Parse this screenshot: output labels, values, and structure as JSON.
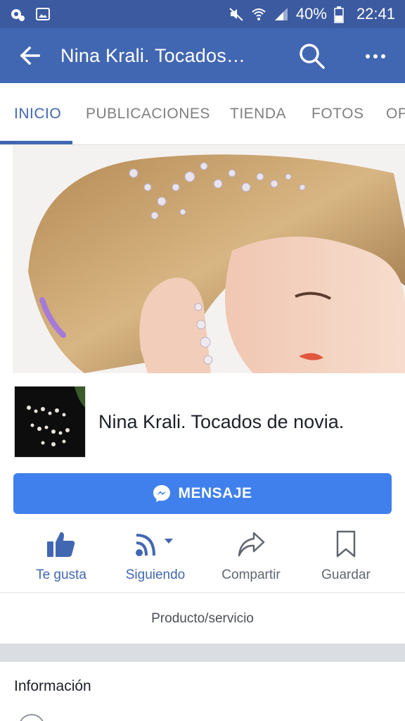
{
  "status_bar": {
    "battery": "40%",
    "time": "22:41",
    "icons": [
      "settings-notification-icon",
      "gallery-notification-icon",
      "mute-icon",
      "wifi-icon",
      "signal-icon",
      "battery-icon"
    ]
  },
  "app_bar": {
    "title": "Nina Krali. Tocados…",
    "icons": [
      "back-arrow-icon",
      "search-icon",
      "more-icon"
    ]
  },
  "tabs": [
    {
      "label": "INICIO",
      "active": true
    },
    {
      "label": "PUBLICACIONES",
      "active": false
    },
    {
      "label": "TIENDA",
      "active": false
    },
    {
      "label": "FOTOS",
      "active": false
    },
    {
      "label": "OP",
      "active": false
    }
  ],
  "page": {
    "name": "Nina Krali. Tocados de novia.",
    "category": "Producto/servicio"
  },
  "message_button": {
    "label": "MENSAJE",
    "icon": "messenger-icon"
  },
  "actions": [
    {
      "label": "Te gusta",
      "icon": "thumbs-up-icon"
    },
    {
      "label": "Siguiendo",
      "icon": "rss-follow-icon"
    },
    {
      "label": "Compartir",
      "icon": "share-icon"
    },
    {
      "label": "Guardar",
      "icon": "bookmark-icon"
    }
  ],
  "info": {
    "title": "Información"
  },
  "colors": {
    "status_bar": "#3b5aa0",
    "app_bar": "#4267b2",
    "accent": "#4267b2",
    "message_button": "#4080ec"
  }
}
